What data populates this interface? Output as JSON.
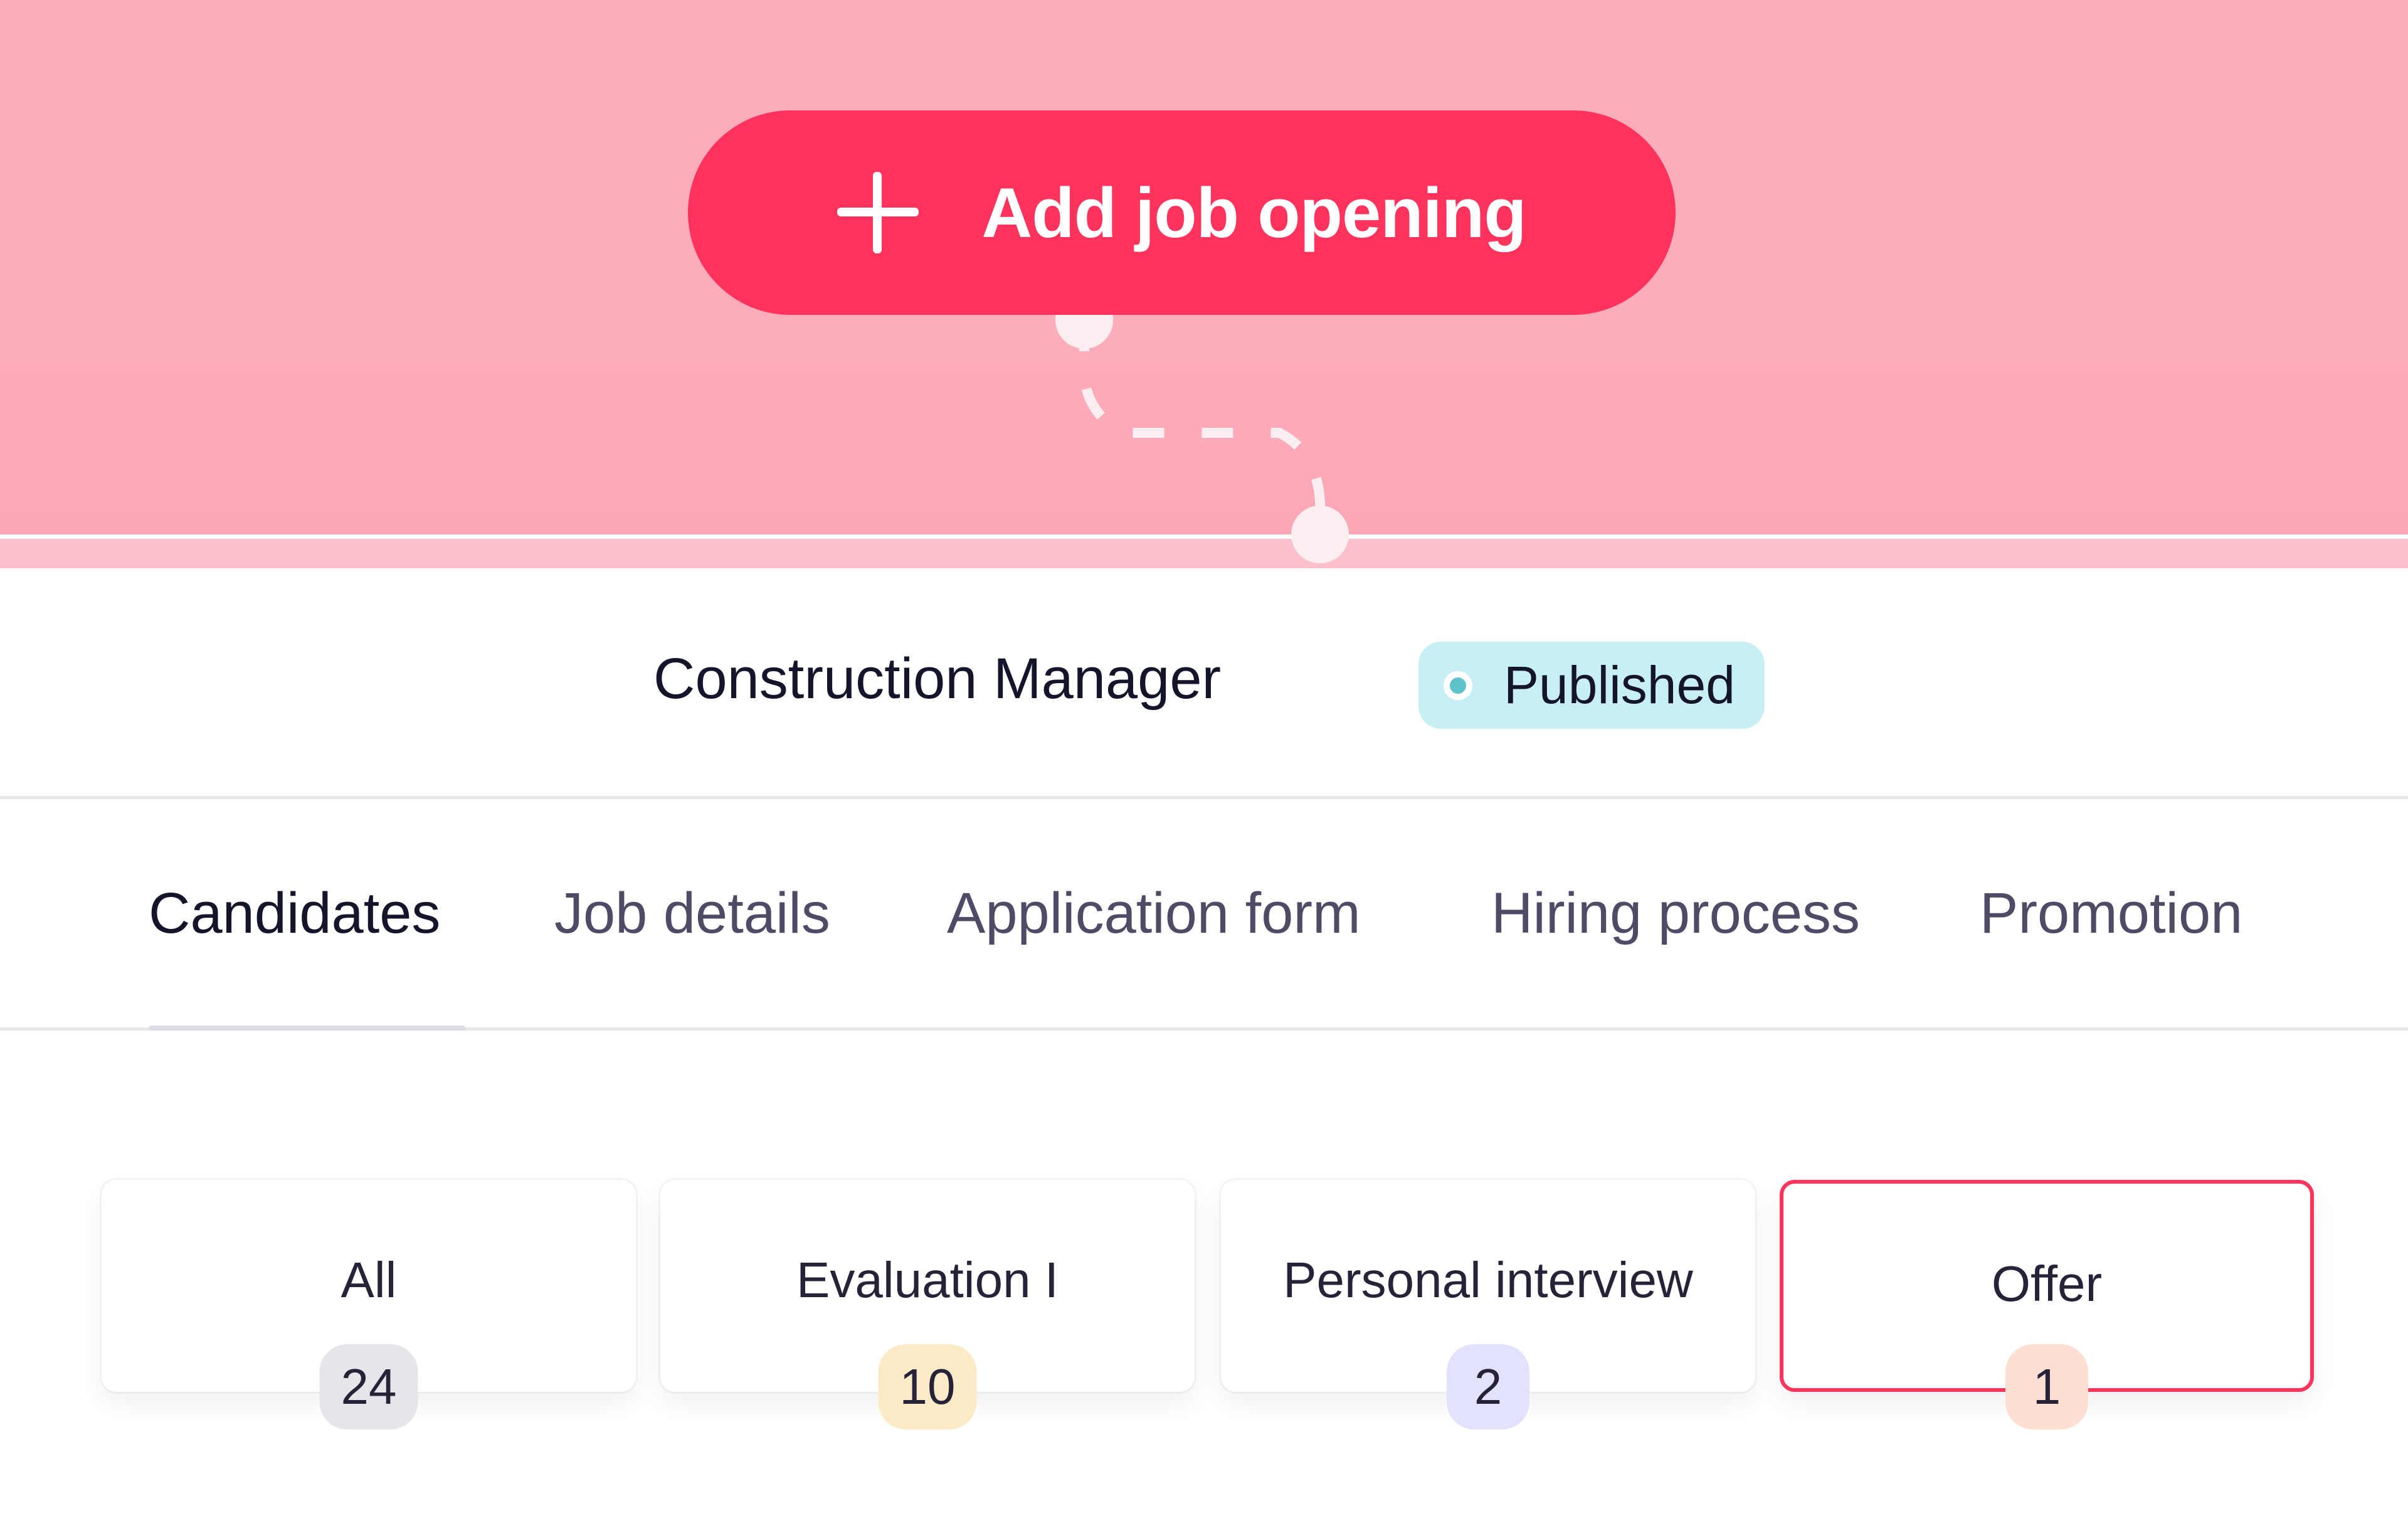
{
  "header": {
    "add_button_label": "Add job opening",
    "add_button_icon": "plus-icon",
    "colors": {
      "hero_bg": "#fdacbb",
      "accent": "#ff335c"
    }
  },
  "job": {
    "title": "Construction Manager",
    "status": "Published",
    "status_color": "#5ec3cb"
  },
  "tabs": [
    {
      "label": "Candidates",
      "active": true
    },
    {
      "label": "Job details",
      "active": false
    },
    {
      "label": "Application form",
      "active": false
    },
    {
      "label": "Hiring process",
      "active": false
    },
    {
      "label": "Promotion",
      "active": false
    }
  ],
  "stages": [
    {
      "label": "All",
      "count": "24",
      "badge_color": "#e6e6ea",
      "selected": false
    },
    {
      "label": "Evaluation I",
      "count": "10",
      "badge_color": "#fdebc8",
      "selected": false
    },
    {
      "label": "Personal interview",
      "count": "2",
      "badge_color": "#e3e2fc",
      "selected": false
    },
    {
      "label": "Offer",
      "count": "1",
      "badge_color": "#fde0d2",
      "selected": true
    }
  ]
}
